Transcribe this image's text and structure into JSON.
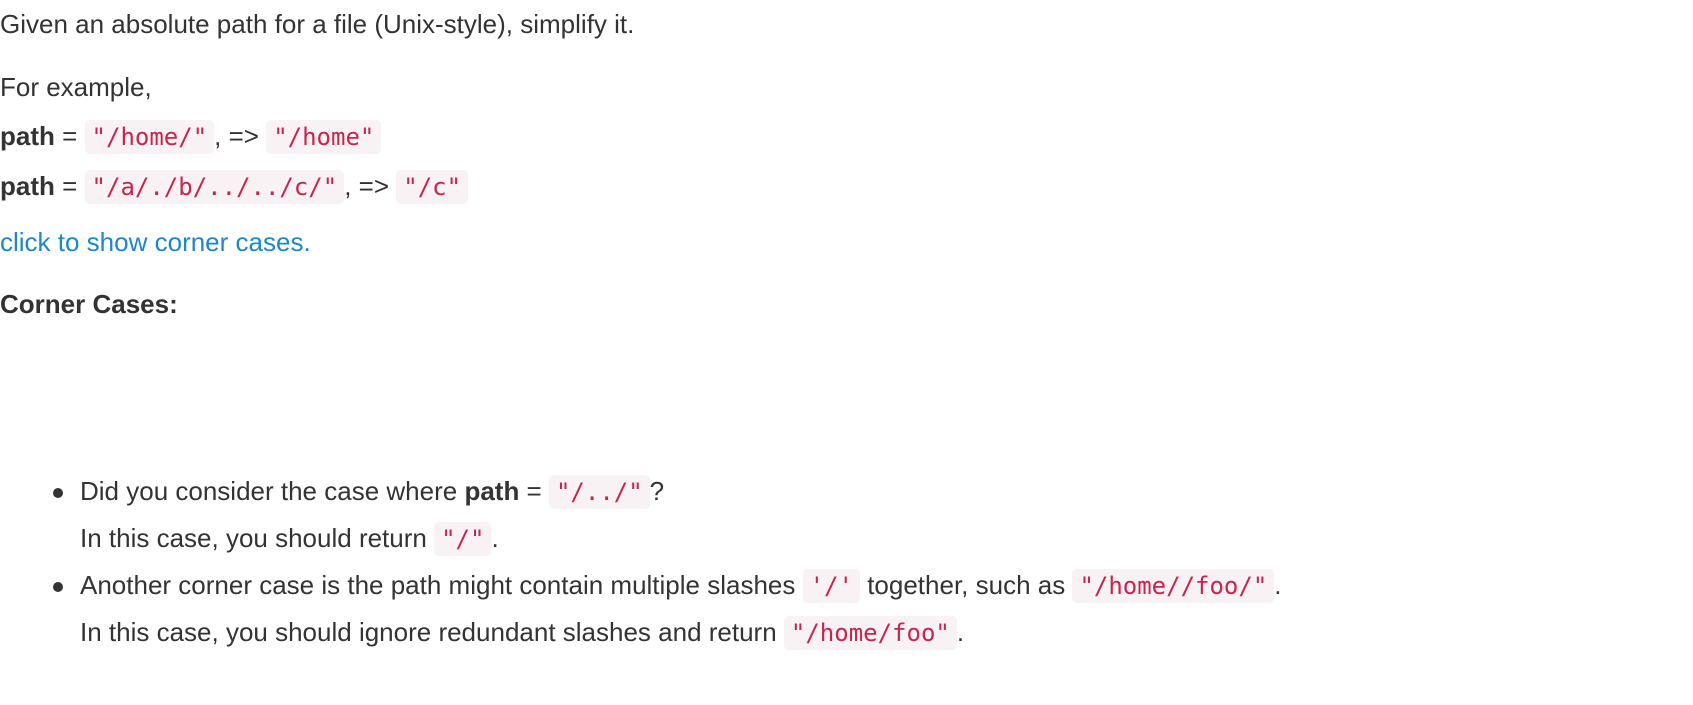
{
  "intro": {
    "text": "Given an absolute path for a file (Unix-style), simplify it."
  },
  "example": {
    "heading": "For example,",
    "rows": [
      {
        "label": "path",
        "eq": "=",
        "input": "\"/home/\"",
        "arrow": ", =>",
        "output": "\"/home\""
      },
      {
        "label": "path",
        "eq": "=",
        "input": "\"/a/./b/../../c/\"",
        "arrow": ", =>",
        "output": "\"/c\""
      }
    ]
  },
  "link": {
    "text": "click to show corner cases."
  },
  "corner": {
    "heading": "Corner Cases:",
    "items": [
      {
        "line1_before": "Did you consider the case where ",
        "line1_bold": "path",
        "line1_eq": " = ",
        "line1_code": "\"/../\"",
        "line1_after": "?",
        "line2_before": "In this case, you should return ",
        "line2_code": "\"/\"",
        "line2_after": "."
      },
      {
        "line1_before": "Another corner case is the path might contain multiple slashes ",
        "line1_code": "'/'",
        "line1_mid": " together, such as ",
        "line1_code2": "\"/home//foo/\"",
        "line1_after": ".",
        "line2_before": "In this case, you should ignore redundant slashes and return ",
        "line2_code": "\"/home/foo\"",
        "line2_after": "."
      }
    ]
  },
  "colors": {
    "text": "#333333",
    "code_text": "#c7254e",
    "code_bg": "#f9f2f4",
    "link": "#1c87c9"
  }
}
